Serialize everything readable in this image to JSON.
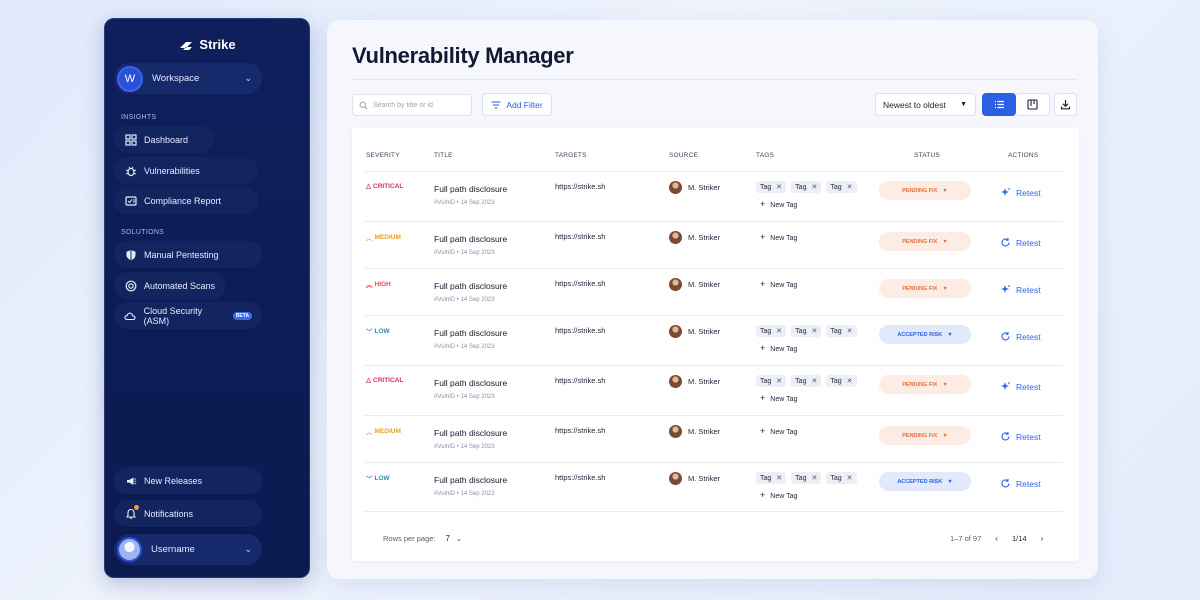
{
  "sidebar": {
    "brand": "Strike",
    "workspace": {
      "initial": "W",
      "label": "Workspace"
    },
    "sections": {
      "insights": "INSIGHTS",
      "solutions": "SOLUTIONS"
    },
    "items": [
      {
        "label": "Dashboard",
        "icon": "dashboard-icon"
      },
      {
        "label": "Vulnerabilities",
        "icon": "bug-icon"
      },
      {
        "label": "Compliance Report",
        "icon": "report-icon"
      },
      {
        "label": "Manual Pentesting",
        "icon": "shield-icon"
      },
      {
        "label": "Automated Scans",
        "icon": "target-icon"
      },
      {
        "label": "Cloud Security (ASM)",
        "icon": "cloud-icon",
        "badge": "BETA"
      }
    ],
    "bottom": {
      "releases": "New Releases",
      "notifications": "Notifications",
      "user": "Username"
    }
  },
  "main": {
    "title": "Vulnerability Manager",
    "search_placeholder": "Search by title or id",
    "add_filter": "Add Filter",
    "sort": "Newest to oldest",
    "columns": {
      "severity": "SEVERITY",
      "title": "TITLE",
      "targets": "TARGETS",
      "source": "SOURCE",
      "tags": "TAGS",
      "status": "STATUS",
      "actions": "ACTIONS"
    },
    "rows": [
      {
        "severity": "CRITICAL",
        "title": "Full path disclosure",
        "id": "#VulnID",
        "date": "14 Sep 2023",
        "target": "https://strike.sh",
        "source": "M. Striker",
        "tags": [
          "Tag",
          "Tag",
          "Tag"
        ],
        "new_tag": "New Tag",
        "status": "PENDING FIX",
        "action": "Retest"
      },
      {
        "severity": "MEDIUM",
        "title": "Full path disclosure",
        "id": "#VulnID",
        "date": "14 Sep 2023",
        "target": "https://strike.sh",
        "source": "M. Striker",
        "tags": [],
        "new_tag": "New Tag",
        "status": "PENDING FIX",
        "action": "Retest"
      },
      {
        "severity": "HIGH",
        "title": "Full path disclosure",
        "id": "#VulnID",
        "date": "14 Sep 2023",
        "target": "https://strike.sh",
        "source": "M. Striker",
        "tags": [],
        "new_tag": "New Tag",
        "status": "PENDING FIX",
        "action": "Retest"
      },
      {
        "severity": "LOW",
        "title": "Full path disclosure",
        "id": "#VulnID",
        "date": "14 Sep 2023",
        "target": "https://strike.sh",
        "source": "M. Striker",
        "tags": [
          "Tag",
          "Tag",
          "Tag"
        ],
        "new_tag": "New Tag",
        "status": "ACCEPTED RISK",
        "action": "Retest"
      },
      {
        "severity": "CRITICAL",
        "title": "Full path disclosure",
        "id": "#VulnID",
        "date": "14 Sep 2023",
        "target": "https://strike.sh",
        "source": "M. Striker",
        "tags": [
          "Tag",
          "Tag",
          "Tag"
        ],
        "new_tag": "New Tag",
        "status": "PENDING FIX",
        "action": "Retest"
      },
      {
        "severity": "MEDIUM",
        "title": "Full path disclosure",
        "id": "#VulnID",
        "date": "14 Sep 2023",
        "target": "https://strike.sh",
        "source": "M. Striker",
        "tags": [],
        "new_tag": "New Tag",
        "status": "PENDING FIX",
        "action": "Retest"
      },
      {
        "severity": "LOW",
        "title": "Full path disclosure",
        "id": "#VulnID",
        "date": "14 Sep 2023",
        "target": "https://strike.sh",
        "source": "M. Striker",
        "tags": [
          "Tag",
          "Tag",
          "Tag"
        ],
        "new_tag": "New Tag",
        "status": "ACCEPTED RISK",
        "action": "Retest"
      }
    ],
    "footer": {
      "rows_per_page_label": "Rows per page:",
      "rows_per_page": "7",
      "range": "1–7 of 97",
      "page": "1/14"
    }
  },
  "colors": {
    "accent": "#2b5fe4",
    "sidebar_bg": "#0e1f5c",
    "critical": "#d42f57",
    "medium": "#e7a128",
    "high": "#e2475d",
    "low": "#2a8ea8",
    "pending_bg": "#fdece3",
    "accepted_bg": "#e1e9fb"
  }
}
